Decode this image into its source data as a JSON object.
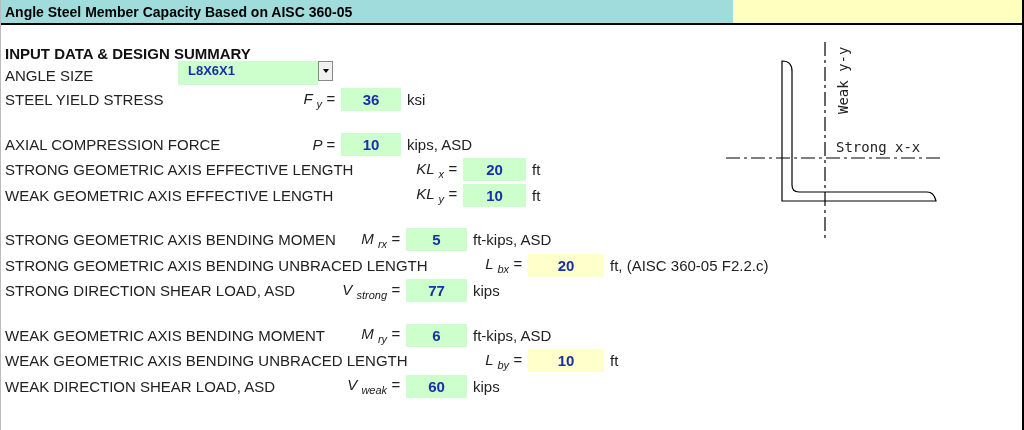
{
  "title": "Angle Steel Member Capacity Based on AISC 360-05",
  "heading": "INPUT DATA & DESIGN SUMMARY",
  "angle_size": {
    "label": "ANGLE SIZE",
    "value": "L8X6X1"
  },
  "groups": [
    [
      {
        "label": "STEEL YIELD STRESS",
        "symbol": "F $_{y}$ =",
        "value": "36",
        "unit": "ksi",
        "kind": "c",
        "color": "#ccffcc"
      }
    ],
    [
      {
        "label": "AXIAL COMPRESSION FORCE",
        "symbol": "P =",
        "value": "10",
        "unit": "kips, ASD",
        "kind": "c",
        "color": "#ccffcc"
      },
      {
        "label": "STRONG GEOMETRIC AXIS EFFECTIVE LENGTH",
        "symbol": "KL $_{x}$ =",
        "value": "20",
        "unit": "ft",
        "kind": "e",
        "color": "#ccffcc"
      },
      {
        "label": "WEAK GEOMETRIC AXIS EFFECTIVE LENGTH",
        "symbol": "KL $_{y}$ =",
        "value": "10",
        "unit": "ft",
        "kind": "e",
        "color": "#ccffcc"
      }
    ],
    [
      {
        "label": "STRONG GEOMETRIC AXIS BENDING MOMEN",
        "symbol": "M $_{rx}$ =",
        "value": "5",
        "unit": "ft-kips, ASD",
        "kind": "d",
        "color": "#ccffcc"
      },
      {
        "label": "STRONG GEOMETRIC AXIS BENDING UNBRACED LENGTH",
        "symbol": "L $_{bx}$ =",
        "value": "20",
        "unit": "ft, (AISC 360-05 F2.2.c)",
        "kind": "f",
        "color": "#ffffcc"
      },
      {
        "label": "STRONG DIRECTION SHEAR LOAD, ASD",
        "symbol": "V $_{strong}$ =",
        "value": "77",
        "unit": "kips",
        "kind": "d",
        "color": "#ccffcc"
      }
    ],
    [
      {
        "label": "WEAK GEOMETRIC AXIS BENDING MOMENT",
        "symbol": "M $_{ry}$ =",
        "value": "6",
        "unit": "ft-kips, ASD",
        "kind": "d",
        "color": "#ccffcc"
      },
      {
        "label": "WEAK GEOMETRIC AXIS BENDING UNBRACED LENGTH",
        "symbol": "L $_{by}$ =",
        "value": "10",
        "unit": "ft",
        "kind": "f",
        "color": "#ffffcc"
      },
      {
        "label": "WEAK DIRECTION SHEAR LOAD, ASD",
        "symbol": "V $_{weak}$ =",
        "value": "60",
        "unit": "kips",
        "kind": "d",
        "color": "#ccffcc"
      }
    ]
  ],
  "diagram": {
    "weak_axis_label": "Weak y-y",
    "strong_axis_label": "Strong x-x"
  }
}
